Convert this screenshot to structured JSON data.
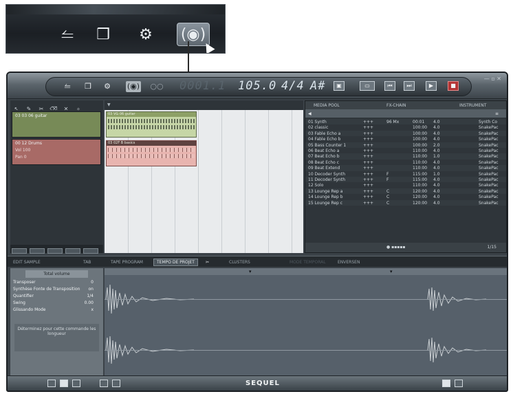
{
  "callout": {
    "icons": [
      "connection-icon",
      "package-icon",
      "gear-icon",
      "media-browser-icon"
    ],
    "active": "media-browser-icon"
  },
  "toolbar": {
    "position_display": "0001.1",
    "tempo": "105.0",
    "signature": "4/4",
    "key": "A#"
  },
  "tracks": [
    {
      "name": "03 03 06 guitar",
      "color": "#778a57"
    },
    {
      "name": "00 12 Drums",
      "color": "#a86a66",
      "vol_label": "Vol",
      "vol_value": "100",
      "pan_label": "Pan",
      "pan_value": "0"
    }
  ],
  "clips": [
    {
      "name": "03 VG 06 guitar"
    },
    {
      "name": "03 02F B basics"
    }
  ],
  "media_browser": {
    "tabs": [
      "MEDIA POOL",
      "FX-CHAIN",
      "INSTRUMENT"
    ],
    "rows": [
      [
        "01 Synth",
        "+++",
        "96 Mx",
        "00:01",
        "4.0",
        "Synth Co"
      ],
      [
        "02 classic",
        "+++",
        "",
        "100:00",
        "4.0",
        "SnakePac"
      ],
      [
        "03 Fable Echo a",
        "+++",
        "",
        "100:00",
        "4.0",
        "SnakePac"
      ],
      [
        "04 Fable Echo b",
        "+++",
        "",
        "100:00",
        "4.0",
        "SnakePac"
      ],
      [
        "05 Bass Counter 1",
        "+++",
        "",
        "100:00",
        "2.0",
        "SnakePac"
      ],
      [
        "06 Beat Echo a",
        "+++",
        "",
        "110:00",
        "4.0",
        "SnakePac"
      ],
      [
        "07 Beat Echo b",
        "+++",
        "",
        "110:00",
        "1.0",
        "SnakePac"
      ],
      [
        "08 Beat Echo c",
        "+++",
        "",
        "110:00",
        "4.0",
        "SnakePac"
      ],
      [
        "09 Beat Extend",
        "+++",
        "",
        "110:00",
        "4.0",
        "SnakePac"
      ],
      [
        "10 Decoder Synth",
        "+++",
        "F",
        "115:00",
        "1.0",
        "SnakePac"
      ],
      [
        "11 Decoder Synth",
        "+++",
        "F",
        "115:00",
        "4.0",
        "SnakePac"
      ],
      [
        "12 Solo",
        "+++",
        "",
        "110:00",
        "4.0",
        "SnakePac"
      ],
      [
        "13 Lounge Rep a",
        "+++",
        "C",
        "120:00",
        "4.0",
        "SnakePac"
      ],
      [
        "14 Lounge Rep b",
        "+++",
        "C",
        "120:00",
        "4.0",
        "SnakePac"
      ],
      [
        "15 Lounge Rep c",
        "+++",
        "C",
        "120:00",
        "4.0",
        "SnakePac"
      ]
    ],
    "footer": "1/15"
  },
  "lower_tabs": [
    "EDIT SAMPLE",
    "TAB",
    "TAPE PROGRAM",
    "TEMPO DE PROJET",
    "CLUSTERS",
    "MODE TEMPORAL",
    "ENVERSEN"
  ],
  "inspector": {
    "header": "Total volume",
    "params": [
      {
        "label": "Transposer",
        "value": "0"
      },
      {
        "label": "Synthèse Fonte de Transposition",
        "value": "on"
      },
      {
        "label": "Quantifier",
        "value": "1/4"
      },
      {
        "label": "Swing",
        "value": "0.00"
      },
      {
        "label": "Glissando Mode",
        "value": "x"
      }
    ],
    "note": "Déterminez pour cette commande les longueur"
  },
  "status": {
    "logo": "SEQUEL"
  }
}
